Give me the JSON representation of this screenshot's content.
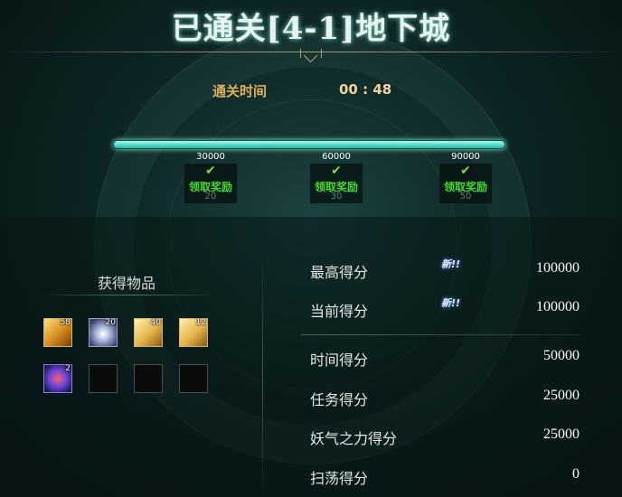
{
  "title": "已通关[4-1]地下城",
  "clear_time": {
    "label": "通关时间",
    "value": "00 : 48"
  },
  "progress_fraction": 1.0,
  "milestones": [
    {
      "score": "30000",
      "claim_label": "领取奖励",
      "number": "20"
    },
    {
      "score": "60000",
      "claim_label": "领取奖励",
      "number": "30"
    },
    {
      "score": "90000",
      "claim_label": "领取奖励",
      "number": "50"
    }
  ],
  "items": {
    "title": "获得物品",
    "slots": [
      {
        "icon": "gold-scroll-icon",
        "count": "58"
      },
      {
        "icon": "silver-orb-icon",
        "count": "20"
      },
      {
        "icon": "gold-card-icon",
        "count": "40"
      },
      {
        "icon": "gold-cards-icon",
        "count": "12"
      },
      {
        "icon": "gem-ball-icon",
        "count": "2"
      },
      {
        "icon": "",
        "count": ""
      },
      {
        "icon": "",
        "count": ""
      },
      {
        "icon": "",
        "count": ""
      }
    ]
  },
  "scores": [
    {
      "label": "最高得分",
      "value": "100000",
      "badge": "新!!"
    },
    {
      "label": "当前得分",
      "value": "100000",
      "badge": "新!!"
    },
    {
      "label": "时间得分",
      "value": "50000"
    },
    {
      "label": "任务得分",
      "value": "25000"
    },
    {
      "label": "妖气之力得分",
      "value": "25000"
    },
    {
      "label": "扫荡得分",
      "value": "0"
    }
  ],
  "colors": {
    "progress_fill": "#4fd9c4",
    "claim_text": "#49d33a",
    "time_label": "#e0b15c"
  }
}
